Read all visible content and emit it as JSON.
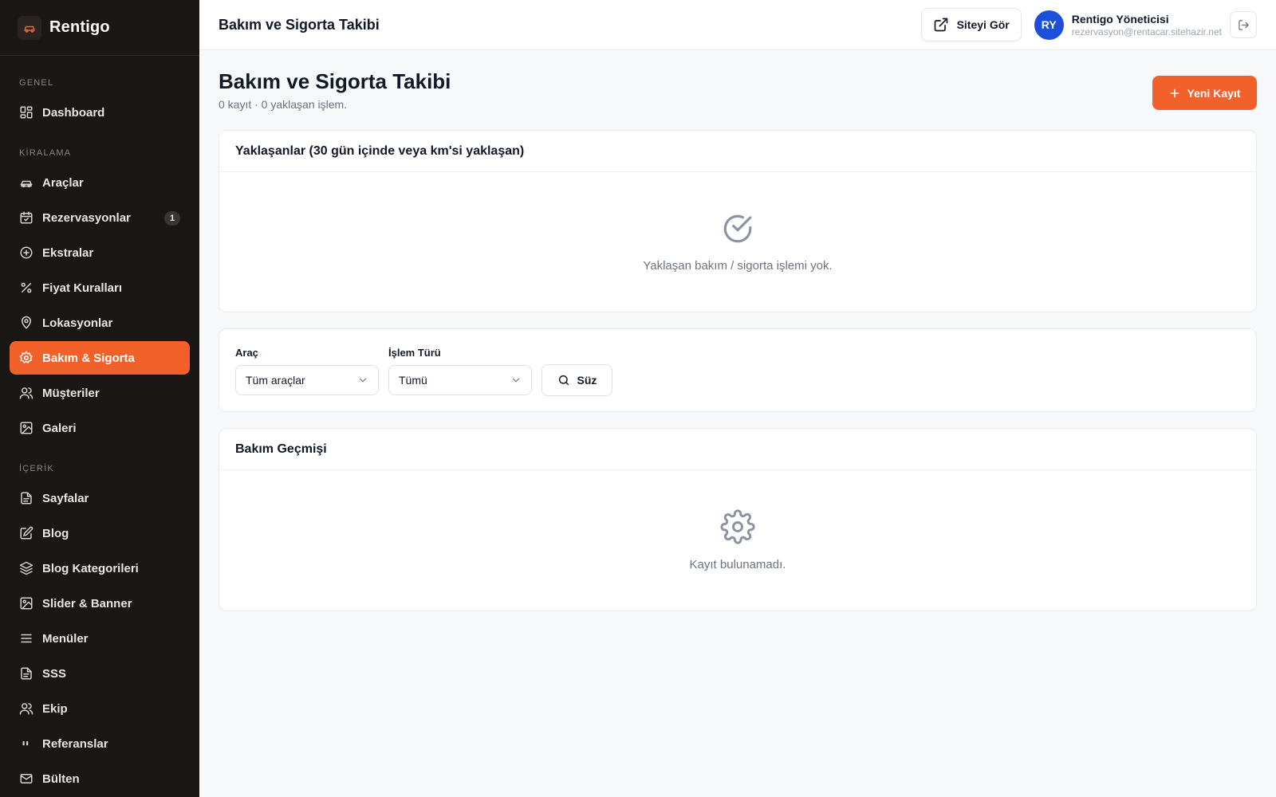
{
  "brand": {
    "name": "Rentigo",
    "logo_icon": "car-icon"
  },
  "sidebar": {
    "sections": [
      {
        "label": "GENEL",
        "items": [
          {
            "label": "Dashboard",
            "icon": "dashboard-icon"
          }
        ]
      },
      {
        "label": "KİRALAMA",
        "items": [
          {
            "label": "Araçlar",
            "icon": "car-icon"
          },
          {
            "label": "Rezervasyonlar",
            "icon": "calendar-icon",
            "badge": "1"
          },
          {
            "label": "Ekstralar",
            "icon": "plus-circle-icon"
          },
          {
            "label": "Fiyat Kuralları",
            "icon": "percent-icon"
          },
          {
            "label": "Lokasyonlar",
            "icon": "map-pin-icon"
          },
          {
            "label": "Bakım & Sigorta",
            "icon": "gear-icon",
            "active": true
          },
          {
            "label": "Müşteriler",
            "icon": "users-icon"
          },
          {
            "label": "Galeri",
            "icon": "image-icon"
          }
        ]
      },
      {
        "label": "İÇERİK",
        "items": [
          {
            "label": "Sayfalar",
            "icon": "file-icon"
          },
          {
            "label": "Blog",
            "icon": "edit-icon"
          },
          {
            "label": "Blog Kategorileri",
            "icon": "layers-icon"
          },
          {
            "label": "Slider & Banner",
            "icon": "image-icon"
          },
          {
            "label": "Menüler",
            "icon": "menu-icon"
          },
          {
            "label": "SSS",
            "icon": "file-icon"
          },
          {
            "label": "Ekip",
            "icon": "users-icon"
          },
          {
            "label": "Referanslar",
            "icon": "quote-icon"
          },
          {
            "label": "Bülten",
            "icon": "mail-icon"
          }
        ]
      }
    ]
  },
  "topbar": {
    "title": "Bakım ve Sigorta Takibi",
    "site_button": "Siteyi Gör",
    "user": {
      "initials": "RY",
      "name": "Rentigo Yöneticisi",
      "email": "rezervasyon@rentacar.sitehazir.net"
    }
  },
  "page": {
    "title": "Bakım ve Sigorta Takibi",
    "subtitle": "0 kayıt · 0 yaklaşan işlem.",
    "new_button": "Yeni Kayıt"
  },
  "upcoming": {
    "title": "Yaklaşanlar (30 gün içinde veya km'si yaklaşan)",
    "empty_text": "Yaklaşan bakım / sigorta işlemi yok.",
    "empty_icon": "check-circle-icon"
  },
  "filters": {
    "vehicle": {
      "label": "Araç",
      "value": "Tüm araçlar"
    },
    "type": {
      "label": "İşlem Türü",
      "value": "Tümü"
    },
    "button": "Süz"
  },
  "history": {
    "title": "Bakım Geçmişi",
    "empty_text": "Kayıt bulunamadı.",
    "empty_icon": "gear-icon"
  },
  "colors": {
    "accent": "#f2612a",
    "sidebar_bg": "#1a1715",
    "avatar_bg": "#1d4fd8"
  }
}
